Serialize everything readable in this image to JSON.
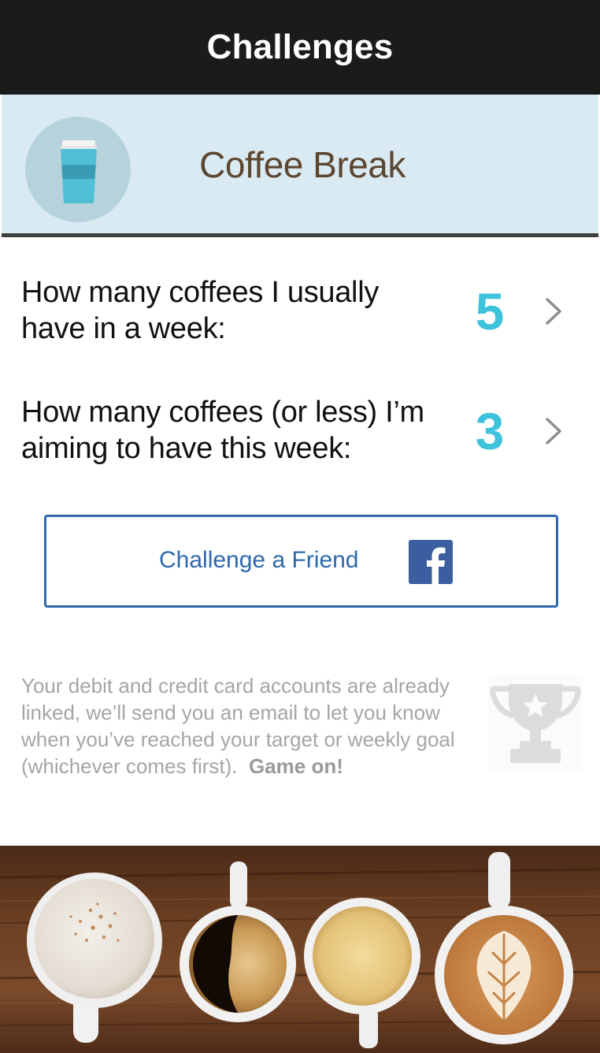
{
  "nav": {
    "title": "Challenges"
  },
  "challenge": {
    "title": "Coffee Break",
    "icon": "coffee-cup-icon"
  },
  "settings": [
    {
      "label_line1": "How many coffees I usually",
      "label_line2": "have in a week:",
      "value": "5"
    },
    {
      "label_line1": "How many coffees (or less) I’m",
      "label_line2": "aiming to have this week:",
      "value": "3"
    }
  ],
  "friend_button": {
    "label": "Challenge a Friend",
    "icon": "facebook-icon"
  },
  "info": {
    "body": "Your debit and credit card accounts are already linked, we’ll send you an email to let you know when you’ve reached your target or weekly goal (whichever comes first).",
    "emphasis": "Game on!"
  },
  "colors": {
    "nav_bg": "#1b1b1b",
    "banner_bg": "#daeaf2",
    "value_accent": "#3ec3dc",
    "button_blue": "#2d69ad",
    "facebook_blue": "#3b5ea0",
    "banner_title": "#5c4630"
  }
}
